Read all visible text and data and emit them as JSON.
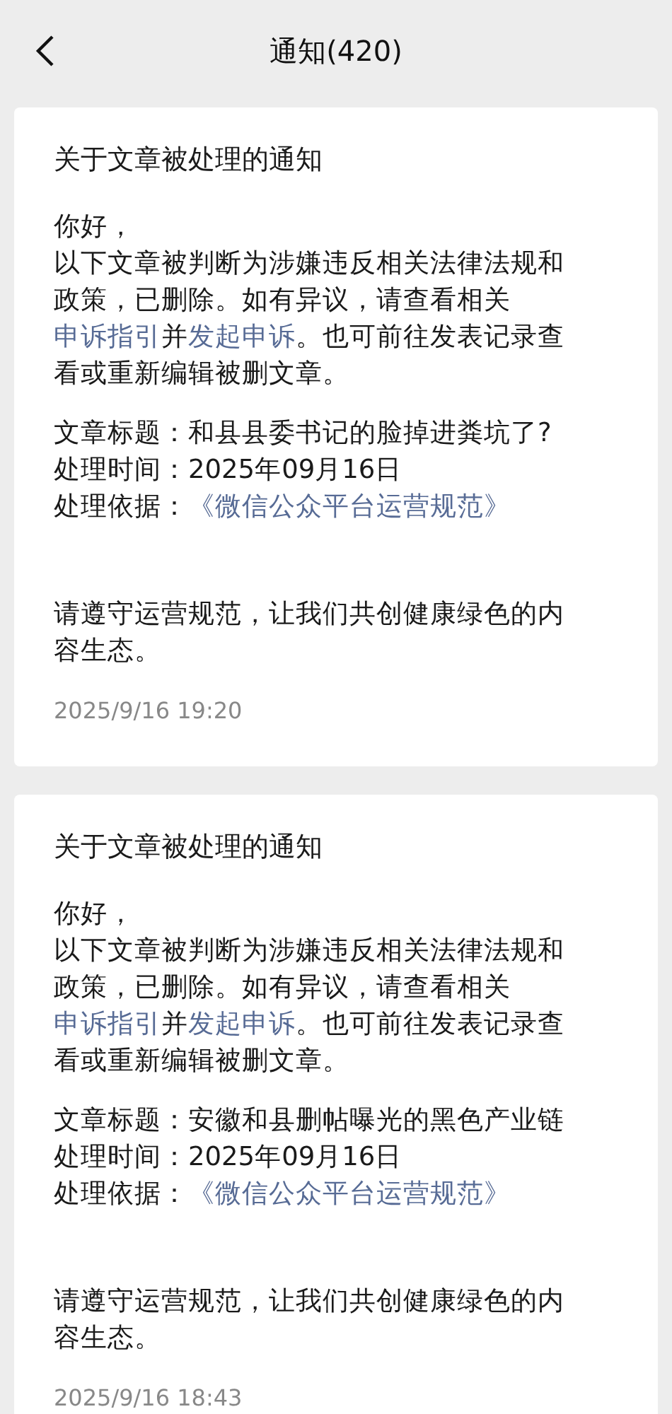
{
  "header": {
    "title": "通知(420)"
  },
  "notices": [
    {
      "title": "关于文章被处理的通知",
      "greeting": "你好，",
      "body": [
        {
          "text": "以下文章被判断为涉嫌违反相关法律法规和政策，已删除。如有异议，请查看相关",
          "link": false
        },
        {
          "text": "申诉指引",
          "link": true
        },
        {
          "text": "并",
          "link": false
        },
        {
          "text": "发起申诉",
          "link": true
        },
        {
          "text": "。也可前往发表记录查看或重新编辑被删文章。",
          "link": false
        }
      ],
      "meta": [
        {
          "label": "文章标题：",
          "value": "和县县委书记的脸掉进粪坑了?",
          "link": false
        },
        {
          "label": "处理时间：",
          "value": "2025年09月16日",
          "link": false
        },
        {
          "label": "处理依据：",
          "value": "《微信公众平台运营规范》",
          "link": true
        }
      ],
      "closing": "请遵守运营规范，让我们共创健康绿色的内容生态。",
      "time": "2025/9/16 19:20"
    },
    {
      "title": "关于文章被处理的通知",
      "greeting": "你好，",
      "body": [
        {
          "text": "以下文章被判断为涉嫌违反相关法律法规和政策，已删除。如有异议，请查看相关",
          "link": false
        },
        {
          "text": "申诉指引",
          "link": true
        },
        {
          "text": "并",
          "link": false
        },
        {
          "text": "发起申诉",
          "link": true
        },
        {
          "text": "。也可前往发表记录查看或重新编辑被删文章。",
          "link": false
        }
      ],
      "meta": [
        {
          "label": "文章标题：",
          "value": "安徽和县删帖曝光的黑色产业链",
          "link": false
        },
        {
          "label": "处理时间：",
          "value": "2025年09月16日",
          "link": false
        },
        {
          "label": "处理依据：",
          "value": "《微信公众平台运营规范》",
          "link": true
        }
      ],
      "closing": "请遵守运营规范，让我们共创健康绿色的内容生态。",
      "time": "2025/9/16 18:43"
    }
  ]
}
